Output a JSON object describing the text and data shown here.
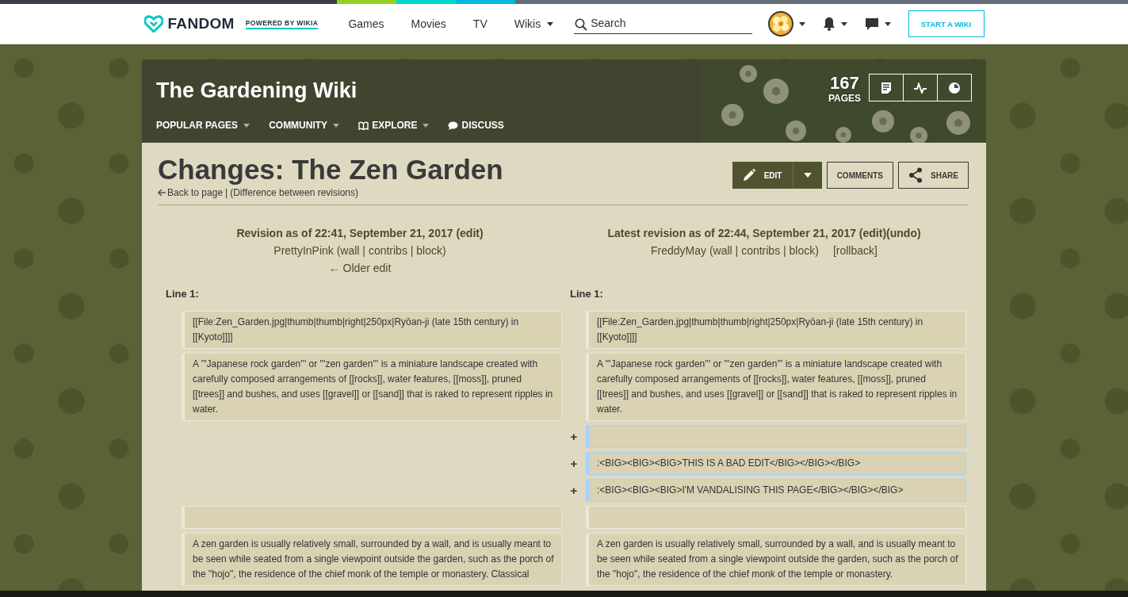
{
  "global_nav": {
    "logo": "FANDOM",
    "tagline": "POWERED BY WIKIA",
    "links": [
      {
        "label": "Games",
        "dropdown": false
      },
      {
        "label": "Movies",
        "dropdown": false
      },
      {
        "label": "TV",
        "dropdown": false
      },
      {
        "label": "Wikis",
        "dropdown": true
      }
    ],
    "search": {
      "placeholder": "Search"
    },
    "start_button": "START A WIKI"
  },
  "wiki_header": {
    "title": "The Gardening Wiki",
    "nav": [
      {
        "label": "POPULAR PAGES",
        "dropdown": true
      },
      {
        "label": "COMMUNITY",
        "dropdown": true
      },
      {
        "label": "EXPLORE",
        "dropdown": true
      },
      {
        "label": "DISCUSS",
        "dropdown": false
      }
    ],
    "page_count": "167",
    "page_count_label": "PAGES"
  },
  "page": {
    "title": "Changes: The Zen Garden",
    "back_link": "Back to page",
    "separator": "|",
    "subtitle": "(Difference between revisions)",
    "buttons": [
      {
        "label": "EDIT",
        "kind": "primary"
      },
      {
        "label": "COMMENTS",
        "kind": "plain"
      },
      {
        "label": "SHARE",
        "kind": "share"
      }
    ]
  },
  "diff": {
    "left": {
      "heading": "Revision as of 22:41, September 21, 2017 (edit)",
      "user": "PrettyInPink (wall | contribs | block)",
      "nav": "← Older edit"
    },
    "right": {
      "heading": "Latest revision as of 22:44, September 21, 2017 (edit)(undo)",
      "user": "FreddyMay (wall | contribs | block)",
      "extra": "[rollback]"
    },
    "line_labels": [
      "Line 1:",
      "Line 1:"
    ],
    "rows": [
      {
        "kind": "context",
        "left": "[[File:Zen_Garden.jpg|thumb|thumb|right|250px|Ryōan-ji (late 15th century) in [[Kyoto]]]]",
        "right": "[[File:Zen_Garden.jpg|thumb|thumb|right|250px|Ryōan-ji (late 15th century) in [[Kyoto]]]]"
      },
      {
        "kind": "context",
        "left": "A '''Japanese rock garden''' or '''zen garden''' is a miniature landscape created with carefully composed arrangements of [[rocks]], water features, [[moss]], pruned [[trees]] and bushes, and uses [[gravel]] or [[sand]] that is raked to represent ripples in water.",
        "right": "A '''Japanese rock garden''' or '''zen garden''' is a miniature landscape created with carefully composed arrangements of [[rocks]], water features, [[moss]], pruned [[trees]] and bushes, and uses [[gravel]] or [[sand]] that is raked to represent ripples in water."
      },
      {
        "kind": "added",
        "marker": "+"
      },
      {
        "kind": "added",
        "marker": "+",
        "right": ":<BIG><BIG><BIG>THIS IS A BAD EDIT</BIG></BIG></BIG>"
      },
      {
        "kind": "added",
        "marker": "+",
        "right": ":<BIG><BIG><BIG>I'M VANDALISING THIS PAGE</BIG></BIG></BIG>"
      },
      {
        "kind": "context"
      },
      {
        "kind": "context",
        "left": "A zen garden is usually relatively small, surrounded by a wall, and is usually meant to be seen while seated from a single viewpoint outside the garden, such as the porch of the \"hojo\", the residence of the chief monk of the temple or monastery. Classical",
        "right": "A zen garden is usually relatively small, surrounded by a wall, and is usually meant to be seen while seated from a single viewpoint outside the garden, such as the porch of the \"hojo\", the residence of the chief monk of the temple or monastery."
      }
    ]
  }
}
